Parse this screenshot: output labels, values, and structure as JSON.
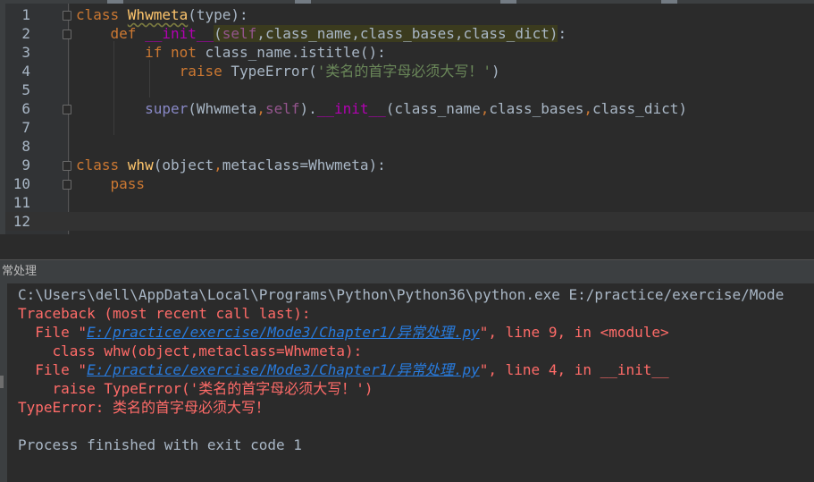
{
  "editor": {
    "lines": [
      {
        "n": "1",
        "parts": [
          [
            "kw",
            "class "
          ],
          [
            "cls",
            "Whwmeta"
          ],
          [
            "par",
            "(type):"
          ]
        ]
      },
      {
        "n": "2",
        "parts": [
          [
            "kw",
            "    def "
          ],
          [
            "magic",
            "__init__"
          ],
          [
            "hl",
            "("
          ],
          [
            "hl-self",
            "self"
          ],
          [
            "hl",
            ","
          ],
          [
            "hl",
            "class_name"
          ],
          [
            "hl",
            ","
          ],
          [
            "hl",
            "class_bases"
          ],
          [
            "hl",
            ","
          ],
          [
            "hl",
            "class_dict"
          ],
          [
            "hl",
            ")"
          ],
          [
            "par",
            ":"
          ]
        ]
      },
      {
        "n": "3",
        "parts": [
          [
            "kw",
            "        if not "
          ],
          [
            "par",
            "class_name.istitle():"
          ]
        ]
      },
      {
        "n": "4",
        "parts": [
          [
            "kw",
            "            raise "
          ],
          [
            "par",
            "TypeError("
          ],
          [
            "str",
            "'类名的首字母必须大写！'"
          ],
          [
            "par",
            ")"
          ]
        ]
      },
      {
        "n": "5",
        "parts": []
      },
      {
        "n": "6",
        "parts": [
          [
            "builtin",
            "        super"
          ],
          [
            "par",
            "(Whwmeta"
          ],
          [
            "kw",
            ","
          ],
          [
            "self",
            "self"
          ],
          [
            "par",
            ")."
          ],
          [
            "magic",
            "__init__"
          ],
          [
            "par",
            "(class_name"
          ],
          [
            "kw",
            ","
          ],
          [
            "par",
            "class_bases"
          ],
          [
            "kw",
            ","
          ],
          [
            "par",
            "class_dict)"
          ]
        ]
      },
      {
        "n": "7",
        "parts": []
      },
      {
        "n": "8",
        "parts": []
      },
      {
        "n": "9",
        "parts": [
          [
            "kw",
            "class "
          ],
          [
            "fn",
            "whw"
          ],
          [
            "par",
            "(object"
          ],
          [
            "kw",
            ","
          ],
          [
            "par",
            "metaclass=Whwmeta):"
          ]
        ]
      },
      {
        "n": "10",
        "parts": [
          [
            "kw",
            "    pass"
          ]
        ]
      },
      {
        "n": "11",
        "parts": []
      },
      {
        "n": "12",
        "parts": []
      }
    ]
  },
  "panel": {
    "title": "常处理"
  },
  "console": {
    "cmd": "C:\\Users\\dell\\AppData\\Local\\Programs\\Python\\Python36\\python.exe E:/practice/exercise/Mode",
    "traceback": "Traceback (most recent call last):",
    "file1_prefix": "  File \"",
    "file1_link": "E:/practice/exercise/Mode3/Chapter1/异常处理.py",
    "file1_suffix": "\", line 9, in <module>",
    "code1": "    class whw(object,metaclass=Whwmeta):",
    "file2_prefix": "  File \"",
    "file2_link": "E:/practice/exercise/Mode3/Chapter1/异常处理.py",
    "file2_suffix": "\", line 4, in __init__",
    "code2": "    raise TypeError('类名的首字母必须大写！')",
    "error": "TypeError: 类名的首字母必须大写！",
    "exit": "Process finished with exit code 1"
  }
}
